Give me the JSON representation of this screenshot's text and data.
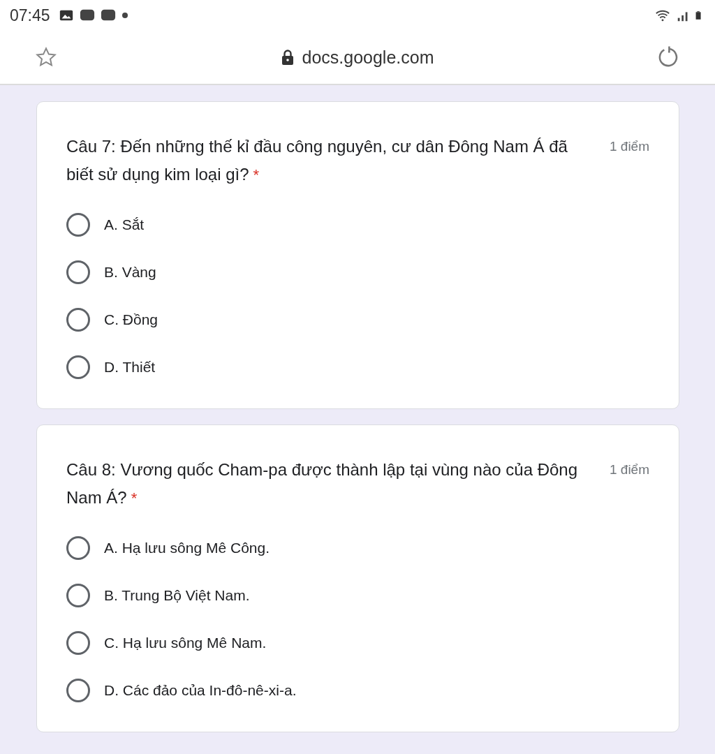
{
  "status_bar": {
    "time": "07:45"
  },
  "browser": {
    "url": "docs.google.com"
  },
  "questions": [
    {
      "title": "Câu 7: Đến những thế kỉ đầu công nguyên, cư dân Đông Nam Á đã biết sử dụng kim loại gì?",
      "required_mark": "*",
      "points": "1 điểm",
      "options": [
        {
          "label": "A. Sắt",
          "selected": false
        },
        {
          "label": "B. Vàng",
          "selected": false
        },
        {
          "label": "C. Đồng",
          "selected": false
        },
        {
          "label": "D. Thiết",
          "selected": false
        }
      ]
    },
    {
      "title": "Câu 8: Vương quốc Cham-pa được thành lập tại vùng nào của Đông Nam Á?",
      "required_mark": "*",
      "points": "1 điểm",
      "options": [
        {
          "label": "A. Hạ lưu sông Mê Công.",
          "selected": false
        },
        {
          "label": "B. Trung Bộ Việt Nam.",
          "selected": false
        },
        {
          "label": "C. Hạ lưu sông Mê Nam.",
          "selected": false
        },
        {
          "label": "D. Các đảo của In-đô-nê-xi-a.",
          "selected": false
        }
      ]
    }
  ]
}
